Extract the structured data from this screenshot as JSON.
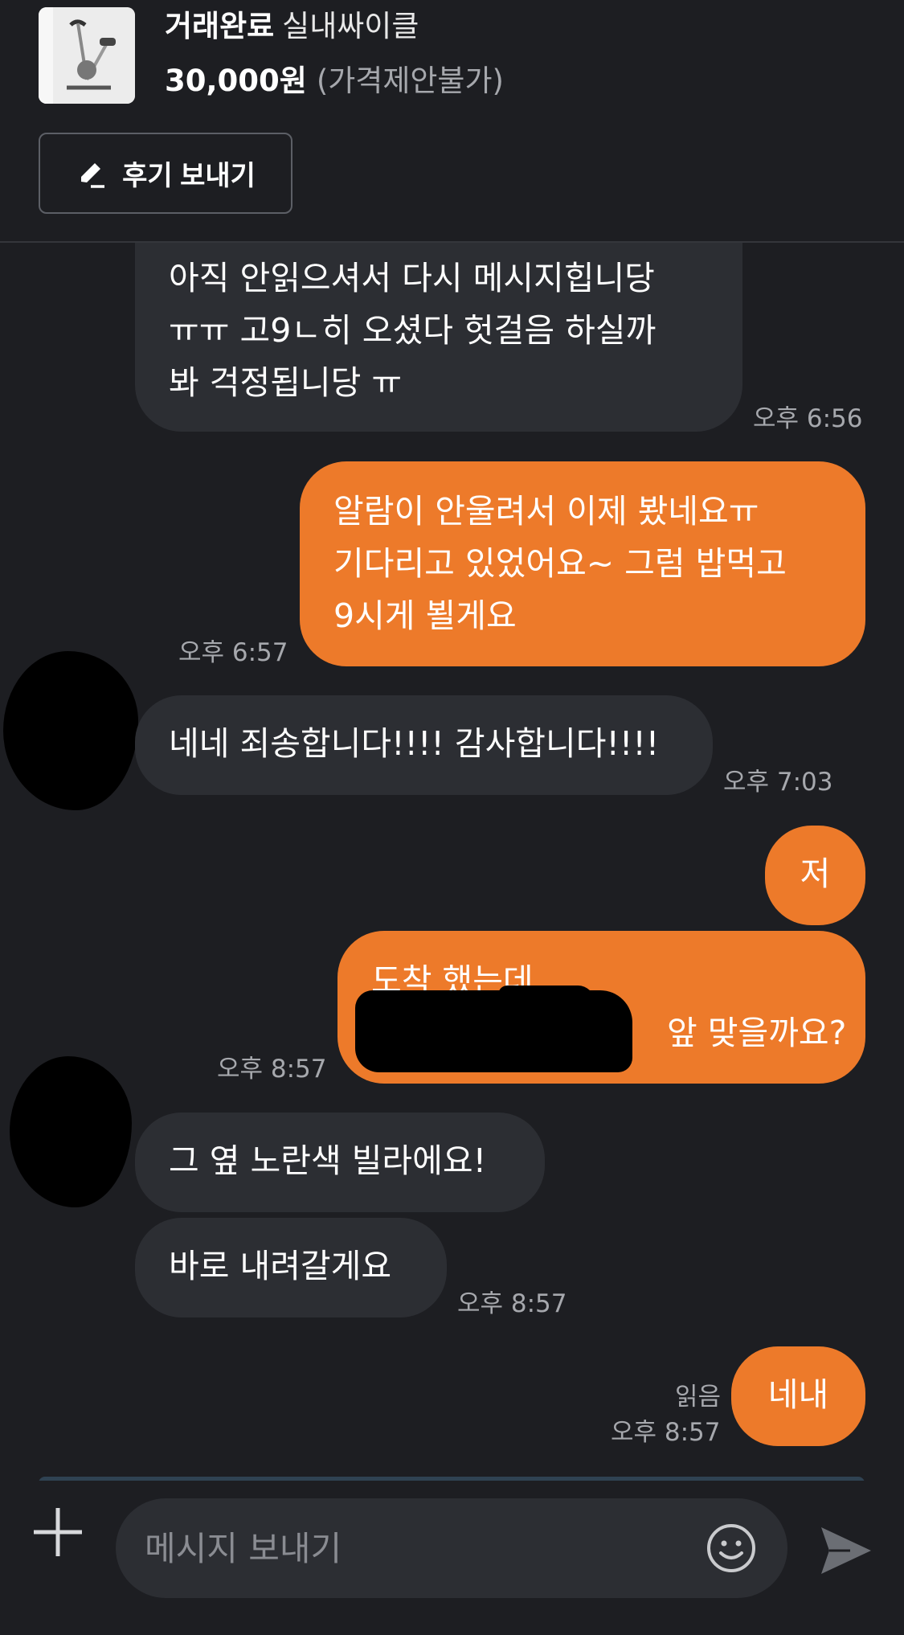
{
  "header": {
    "status": "거래완료",
    "item_name": "실내싸이클",
    "price": "30,000원",
    "negotiation": "(가격제안불가)",
    "review_button": "후기 보내기"
  },
  "messages": [
    {
      "side": "in",
      "lines": [
        "아직 안읽으셔서 다시 메시지힙니당",
        "ㅠㅠ 고9ㄴ히 오셨다 헛걸음 하실까",
        "봐 걱정됩니당 ㅠ"
      ],
      "time": "오후 6:56"
    },
    {
      "side": "out",
      "lines": [
        "알람이 안울려서 이제 봤네요ㅠ",
        "기다리고 있었어요~ 그럼 밥먹고",
        "9시게 뵐게요"
      ],
      "time": "오후 6:57"
    },
    {
      "side": "in",
      "lines": [
        "네네 죄송합니다!!!! 감사합니다!!!!"
      ],
      "time": "오후 7:03"
    },
    {
      "side": "out",
      "lines": [
        "저"
      ]
    },
    {
      "side": "out",
      "lines": [
        "도착 했는데",
        "앞 맞을까요?"
      ],
      "time": "오후 8:57"
    },
    {
      "side": "in",
      "lines": [
        "그 옆 노란색 빌라에요!"
      ]
    },
    {
      "side": "in",
      "lines": [
        "바로 내려갈게요"
      ],
      "time": "오후 8:57"
    },
    {
      "side": "out",
      "lines": [
        "네내"
      ],
      "read": "읽음",
      "time": "오후 8:57"
    }
  ],
  "input": {
    "placeholder": "메시지 보내기"
  },
  "icons": {
    "review": "pencil-icon",
    "attach": "plus-icon",
    "emoji": "emoji-icon",
    "send": "send-icon"
  },
  "colors": {
    "background": "#1d1e22",
    "incoming_bubble": "#2c2e33",
    "outgoing_bubble": "#ed7a2a",
    "muted_text": "#a6a8ad"
  }
}
